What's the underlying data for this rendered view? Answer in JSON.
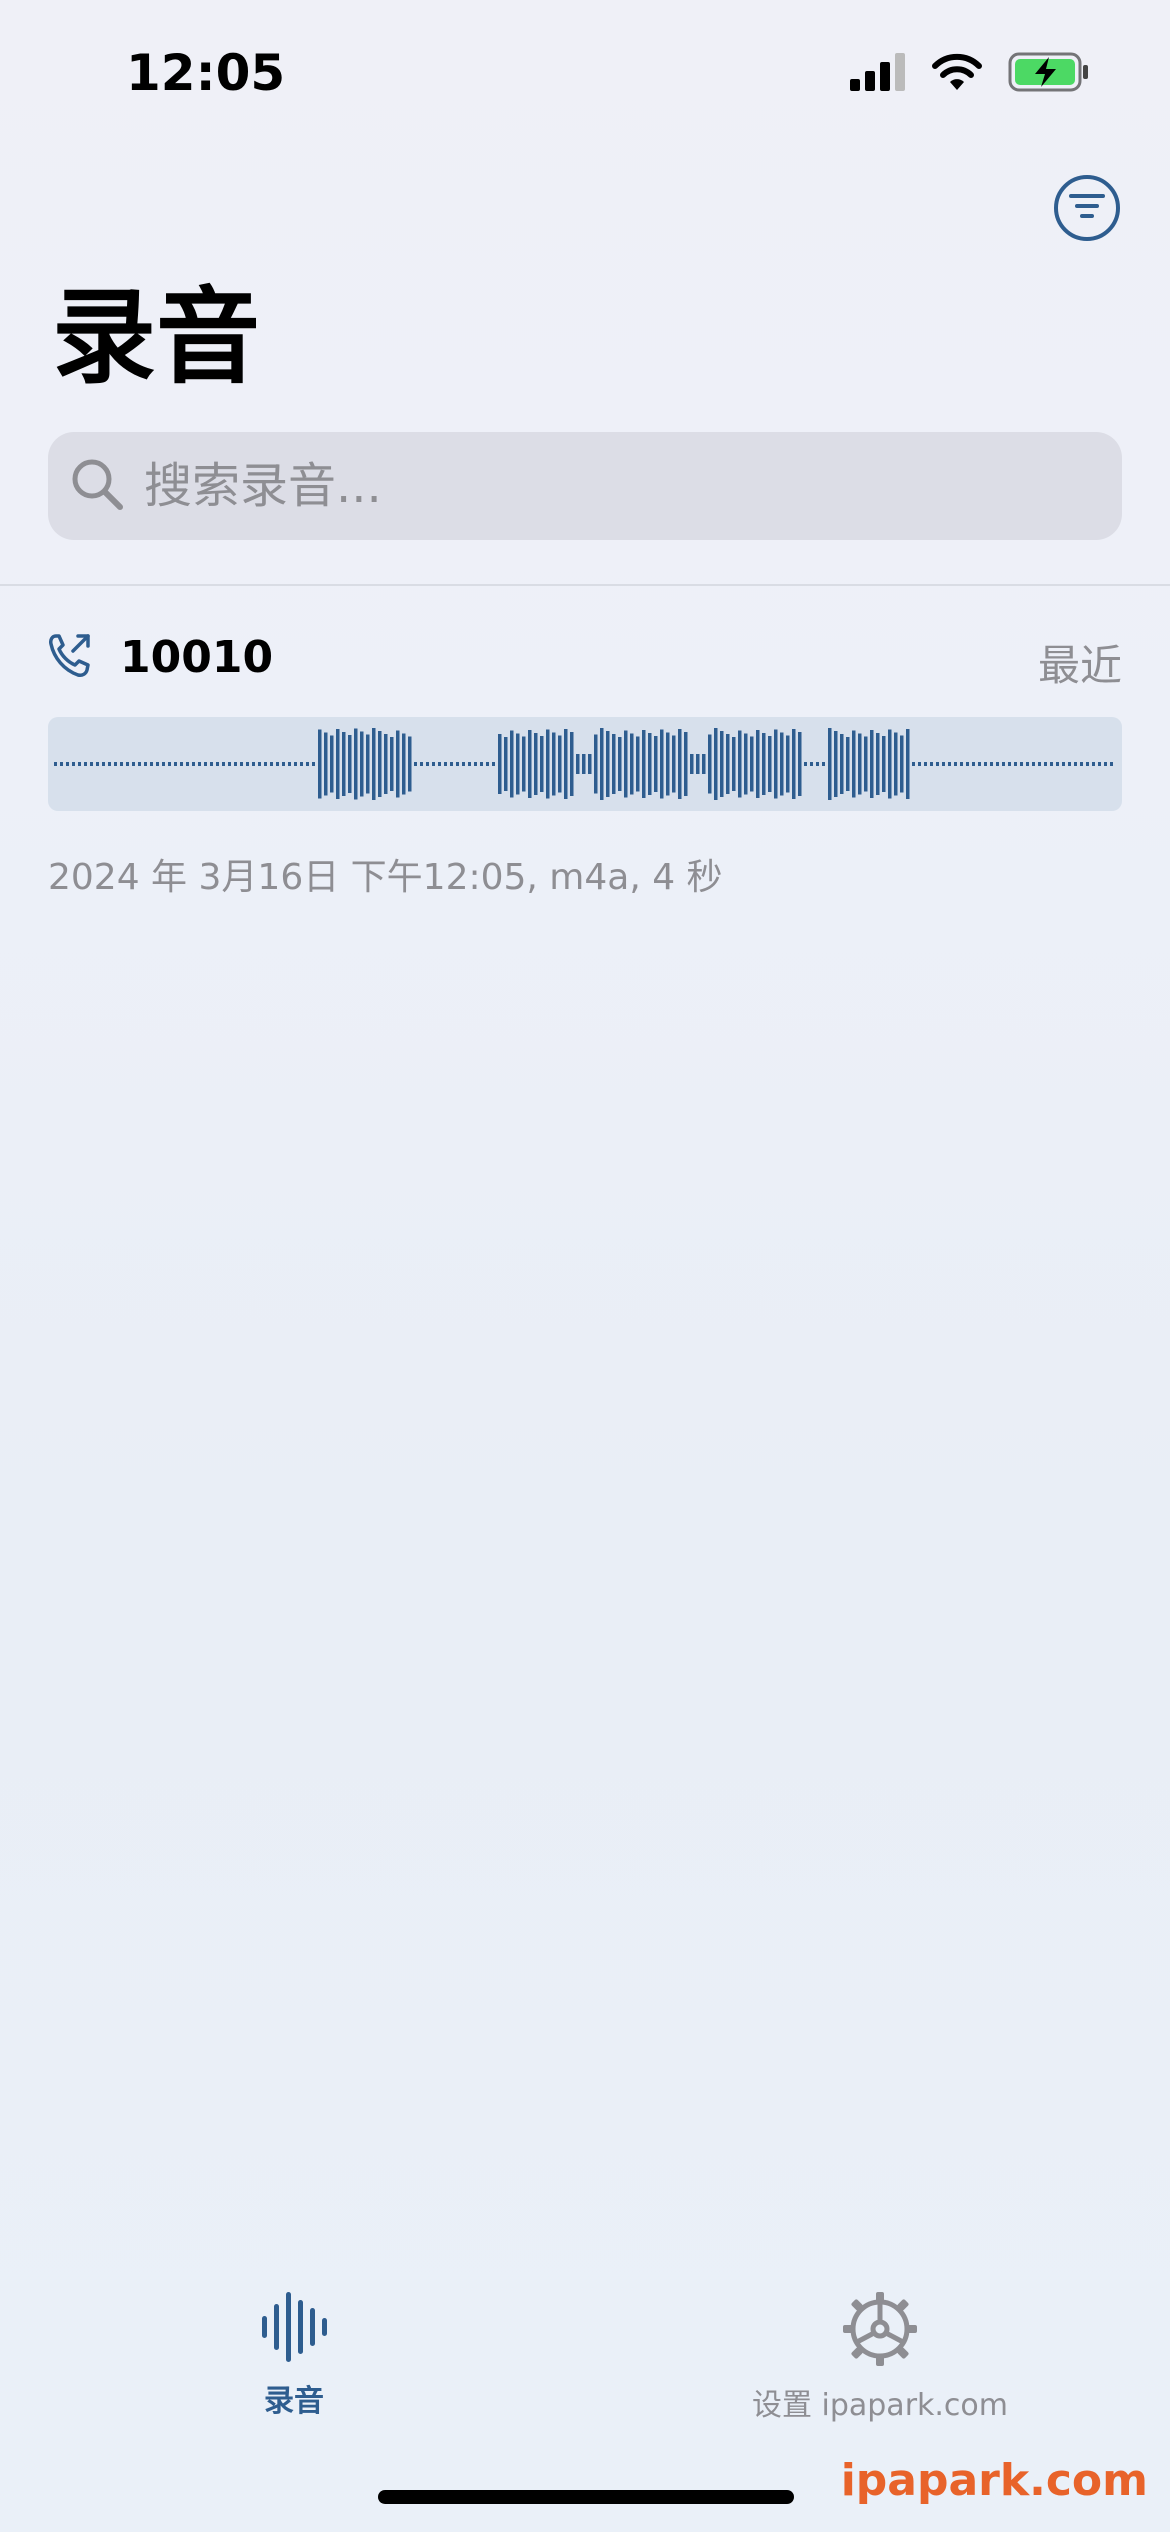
{
  "status": {
    "time": "12:05",
    "icons": [
      "cellular-signal-icon",
      "wifi-icon",
      "battery-charging-icon"
    ]
  },
  "header": {
    "title": "录音",
    "filter_icon": "filter-lines-icon"
  },
  "search": {
    "placeholder": "搜索录音..."
  },
  "recordings": [
    {
      "icon": "phone-outgoing-icon",
      "name": "10010",
      "tag": "最近",
      "meta": "2024 年 3月16日 下午12:05, m4a, 4 秒"
    }
  ],
  "tabbar": {
    "tabs": [
      {
        "label": "录音",
        "icon": "waveform-icon",
        "selected": true
      },
      {
        "label": "设置 ipapark.com",
        "icon": "gear-icon",
        "selected": false
      }
    ]
  },
  "watermark": "ipapark.com",
  "colors": {
    "accent": "#2e5d8f",
    "secondary_text": "#8e8e93",
    "search_bg": "#dcdde6",
    "waveform_bg": "#d7e0ec",
    "watermark": "#e8632a"
  }
}
